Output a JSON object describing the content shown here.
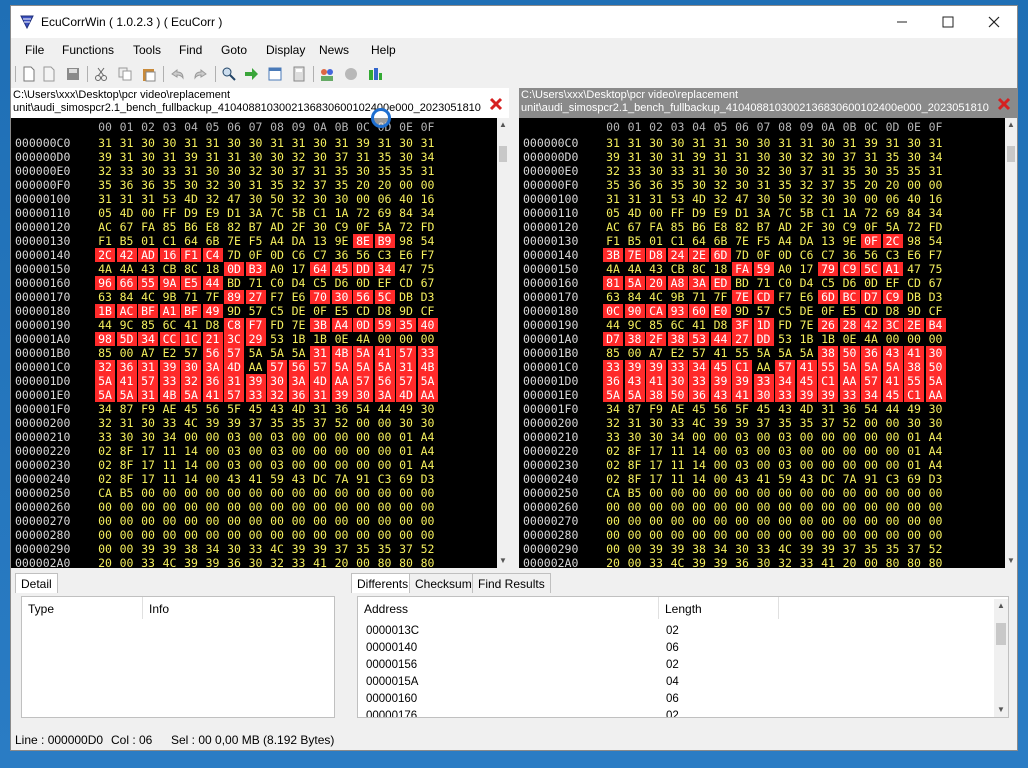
{
  "window": {
    "title": "EcuCorrWin ( 1.0.2.3 ) ( EcuCorr )"
  },
  "menu": [
    "File",
    "Functions",
    "Tools",
    "Find",
    "Goto",
    "Display",
    "News",
    "Help"
  ],
  "toolbar_icons": [
    "new-file-icon",
    "open-file-icon",
    "save-icon",
    "cut-icon",
    "copy-icon",
    "paste-icon",
    "undo-icon",
    "redo-icon",
    "search-icon",
    "goto-arrow-icon",
    "window-icon",
    "calculator-icon",
    "users-icon",
    "record-icon",
    "chart-icon"
  ],
  "left_pane": {
    "path_line1": "C:\\Users\\xxx\\Desktop\\pcr video\\replacement",
    "path_line2": "unit\\audi_simospcr2.1_bench_fullbackup_4104088103002136830600102400e000_2023051810"
  },
  "right_pane": {
    "path_line1": "C:\\Users\\xxx\\Desktop\\pcr video\\replacement",
    "path_line2": "unit\\audi_simospcr2.1_bench_fullbackup_4104088103002136830600102400e000_2023051810"
  },
  "column_header": [
    "00",
    "01",
    "02",
    "03",
    "04",
    "05",
    "06",
    "07",
    "08",
    "09",
    "0A",
    "0B",
    "0C",
    "0D",
    "0E",
    "0F"
  ],
  "addresses": [
    "000000C0",
    "000000D0",
    "000000E0",
    "000000F0",
    "00000100",
    "00000110",
    "00000120",
    "00000130",
    "00000140",
    "00000150",
    "00000160",
    "00000170",
    "00000180",
    "00000190",
    "000001A0",
    "000001B0",
    "000001C0",
    "000001D0",
    "000001E0",
    "000001F0",
    "00000200",
    "00000210",
    "00000220",
    "00000230",
    "00000240",
    "00000250",
    "00000260",
    "00000270",
    "00000280",
    "00000290",
    "000002A0"
  ],
  "left_rows": [
    [
      "31",
      "31",
      "30",
      "30",
      "31",
      "31",
      "30",
      "30",
      "31",
      "31",
      "30",
      "31",
      "39",
      "31",
      "30",
      "31"
    ],
    [
      "39",
      "31",
      "30",
      "31",
      "39",
      "31",
      "31",
      "30",
      "30",
      "32",
      "30",
      "37",
      "31",
      "35",
      "30",
      "34"
    ],
    [
      "32",
      "33",
      "30",
      "33",
      "31",
      "30",
      "30",
      "32",
      "30",
      "37",
      "31",
      "35",
      "30",
      "35",
      "35",
      "31"
    ],
    [
      "35",
      "36",
      "36",
      "35",
      "30",
      "32",
      "30",
      "31",
      "35",
      "32",
      "37",
      "35",
      "20",
      "20",
      "00",
      "00"
    ],
    [
      "31",
      "31",
      "31",
      "53",
      "4D",
      "32",
      "47",
      "30",
      "50",
      "32",
      "30",
      "30",
      "00",
      "06",
      "40",
      "16"
    ],
    [
      "05",
      "4D",
      "00",
      "FF",
      "D9",
      "E9",
      "D1",
      "3A",
      "7C",
      "5B",
      "C1",
      "1A",
      "72",
      "69",
      "84",
      "34"
    ],
    [
      "AC",
      "67",
      "FA",
      "85",
      "B6",
      "E8",
      "82",
      "B7",
      "AD",
      "2F",
      "30",
      "C9",
      "0F",
      "5A",
      "72",
      "FD"
    ],
    [
      "F1",
      "B5",
      "01",
      "C1",
      "64",
      "6B",
      "7E",
      "F5",
      "A4",
      "DA",
      "13",
      "9E",
      "8E",
      "B9",
      "98",
      "54"
    ],
    [
      "2C",
      "42",
      "AD",
      "16",
      "F1",
      "C4",
      "7D",
      "0F",
      "0D",
      "C6",
      "C7",
      "36",
      "56",
      "C3",
      "E6",
      "F7"
    ],
    [
      "4A",
      "4A",
      "43",
      "CB",
      "8C",
      "18",
      "0D",
      "B3",
      "A0",
      "17",
      "64",
      "45",
      "DD",
      "34",
      "47",
      "75"
    ],
    [
      "96",
      "66",
      "55",
      "9A",
      "E5",
      "44",
      "BD",
      "71",
      "C0",
      "D4",
      "C5",
      "D6",
      "0D",
      "EF",
      "CD",
      "67"
    ],
    [
      "63",
      "84",
      "4C",
      "9B",
      "71",
      "7F",
      "89",
      "27",
      "F7",
      "E6",
      "70",
      "30",
      "56",
      "5C",
      "DB",
      "D3"
    ],
    [
      "1B",
      "AC",
      "BF",
      "A1",
      "BF",
      "49",
      "9D",
      "57",
      "C5",
      "DE",
      "0F",
      "E5",
      "CD",
      "D8",
      "9D",
      "CF"
    ],
    [
      "44",
      "9C",
      "85",
      "6C",
      "41",
      "D8",
      "C8",
      "F7",
      "FD",
      "7E",
      "3B",
      "A4",
      "0D",
      "59",
      "35",
      "40"
    ],
    [
      "98",
      "5D",
      "34",
      "CC",
      "1C",
      "21",
      "3C",
      "29",
      "53",
      "1B",
      "1B",
      "0E",
      "4A",
      "00",
      "00",
      "00"
    ],
    [
      "85",
      "00",
      "A7",
      "E2",
      "57",
      "56",
      "57",
      "5A",
      "5A",
      "5A",
      "31",
      "4B",
      "5A",
      "41",
      "57",
      "33"
    ],
    [
      "32",
      "36",
      "31",
      "39",
      "30",
      "3A",
      "4D",
      "AA",
      "57",
      "56",
      "57",
      "5A",
      "5A",
      "5A",
      "31",
      "4B"
    ],
    [
      "5A",
      "41",
      "57",
      "33",
      "32",
      "36",
      "31",
      "39",
      "30",
      "3A",
      "4D",
      "AA",
      "57",
      "56",
      "57",
      "5A"
    ],
    [
      "5A",
      "5A",
      "31",
      "4B",
      "5A",
      "41",
      "57",
      "33",
      "32",
      "36",
      "31",
      "39",
      "30",
      "3A",
      "4D",
      "AA"
    ],
    [
      "34",
      "87",
      "F9",
      "AE",
      "45",
      "56",
      "5F",
      "45",
      "43",
      "4D",
      "31",
      "36",
      "54",
      "44",
      "49",
      "30"
    ],
    [
      "32",
      "31",
      "30",
      "33",
      "4C",
      "39",
      "39",
      "37",
      "35",
      "35",
      "37",
      "52",
      "00",
      "00",
      "30",
      "30"
    ],
    [
      "33",
      "30",
      "30",
      "34",
      "00",
      "00",
      "03",
      "00",
      "03",
      "00",
      "00",
      "00",
      "00",
      "00",
      "01",
      "A4"
    ],
    [
      "02",
      "8F",
      "17",
      "11",
      "14",
      "00",
      "03",
      "00",
      "03",
      "00",
      "00",
      "00",
      "00",
      "00",
      "01",
      "A4"
    ],
    [
      "02",
      "8F",
      "17",
      "11",
      "14",
      "00",
      "03",
      "00",
      "03",
      "00",
      "00",
      "00",
      "00",
      "00",
      "01",
      "A4"
    ],
    [
      "02",
      "8F",
      "17",
      "11",
      "14",
      "00",
      "43",
      "41",
      "59",
      "43",
      "DC",
      "7A",
      "91",
      "C3",
      "69",
      "D3"
    ],
    [
      "CA",
      "B5",
      "00",
      "00",
      "00",
      "00",
      "00",
      "00",
      "00",
      "00",
      "00",
      "00",
      "00",
      "00",
      "00",
      "00"
    ],
    [
      "00",
      "00",
      "00",
      "00",
      "00",
      "00",
      "00",
      "00",
      "00",
      "00",
      "00",
      "00",
      "00",
      "00",
      "00",
      "00"
    ],
    [
      "00",
      "00",
      "00",
      "00",
      "00",
      "00",
      "00",
      "00",
      "00",
      "00",
      "00",
      "00",
      "00",
      "00",
      "00",
      "00"
    ],
    [
      "00",
      "00",
      "00",
      "00",
      "00",
      "00",
      "00",
      "00",
      "00",
      "00",
      "00",
      "00",
      "00",
      "00",
      "00",
      "00"
    ],
    [
      "00",
      "00",
      "39",
      "39",
      "38",
      "34",
      "30",
      "33",
      "4C",
      "39",
      "39",
      "37",
      "35",
      "35",
      "37",
      "52"
    ],
    [
      "20",
      "00",
      "33",
      "4C",
      "39",
      "39",
      "36",
      "30",
      "32",
      "33",
      "41",
      "20",
      "00",
      "80",
      "80",
      "80"
    ]
  ],
  "left_hl": [
    [],
    [],
    [],
    [],
    [],
    [],
    [],
    [
      12,
      13
    ],
    [
      0,
      1,
      2,
      3,
      4,
      5
    ],
    [
      6,
      7,
      10,
      11,
      12,
      13
    ],
    [
      0,
      1,
      2,
      3,
      4,
      5
    ],
    [
      6,
      7,
      10,
      11,
      12,
      13
    ],
    [
      0,
      1,
      2,
      3,
      4,
      5
    ],
    [
      6,
      7,
      10,
      11,
      12,
      13,
      14,
      15
    ],
    [
      0,
      1,
      2,
      3,
      4,
      5,
      6,
      7
    ],
    [
      5,
      6,
      10,
      11,
      12,
      13,
      14,
      15
    ],
    [
      0,
      1,
      2,
      3,
      4,
      5,
      6,
      8,
      9,
      10,
      11,
      12,
      13,
      14,
      15
    ],
    [
      0,
      1,
      2,
      3,
      4,
      5,
      6,
      7,
      8,
      9,
      10,
      11,
      12,
      13,
      14,
      15
    ],
    [
      0,
      1,
      2,
      3,
      4,
      5,
      6,
      7,
      8,
      9,
      10,
      11,
      12,
      13,
      14,
      15
    ],
    [],
    [],
    [],
    [],
    [],
    [],
    [],
    [],
    [],
    [],
    [],
    []
  ],
  "right_rows": [
    [
      "31",
      "31",
      "30",
      "30",
      "31",
      "31",
      "30",
      "30",
      "31",
      "31",
      "30",
      "31",
      "39",
      "31",
      "30",
      "31"
    ],
    [
      "39",
      "31",
      "30",
      "31",
      "39",
      "31",
      "31",
      "30",
      "30",
      "32",
      "30",
      "37",
      "31",
      "35",
      "30",
      "34"
    ],
    [
      "32",
      "33",
      "30",
      "33",
      "31",
      "30",
      "30",
      "32",
      "30",
      "37",
      "31",
      "35",
      "30",
      "35",
      "35",
      "31"
    ],
    [
      "35",
      "36",
      "36",
      "35",
      "30",
      "32",
      "30",
      "31",
      "35",
      "32",
      "37",
      "35",
      "20",
      "20",
      "00",
      "00"
    ],
    [
      "31",
      "31",
      "31",
      "53",
      "4D",
      "32",
      "47",
      "30",
      "50",
      "32",
      "30",
      "30",
      "00",
      "06",
      "40",
      "16"
    ],
    [
      "05",
      "4D",
      "00",
      "FF",
      "D9",
      "E9",
      "D1",
      "3A",
      "7C",
      "5B",
      "C1",
      "1A",
      "72",
      "69",
      "84",
      "34"
    ],
    [
      "AC",
      "67",
      "FA",
      "85",
      "B6",
      "E8",
      "82",
      "B7",
      "AD",
      "2F",
      "30",
      "C9",
      "0F",
      "5A",
      "72",
      "FD"
    ],
    [
      "F1",
      "B5",
      "01",
      "C1",
      "64",
      "6B",
      "7E",
      "F5",
      "A4",
      "DA",
      "13",
      "9E",
      "0F",
      "2C",
      "98",
      "54"
    ],
    [
      "3B",
      "7E",
      "D8",
      "24",
      "2E",
      "6D",
      "7D",
      "0F",
      "0D",
      "C6",
      "C7",
      "36",
      "56",
      "C3",
      "E6",
      "F7"
    ],
    [
      "4A",
      "4A",
      "43",
      "CB",
      "8C",
      "18",
      "FA",
      "59",
      "A0",
      "17",
      "79",
      "C9",
      "5C",
      "A1",
      "47",
      "75"
    ],
    [
      "81",
      "5A",
      "20",
      "A8",
      "3A",
      "ED",
      "BD",
      "71",
      "C0",
      "D4",
      "C5",
      "D6",
      "0D",
      "EF",
      "CD",
      "67"
    ],
    [
      "63",
      "84",
      "4C",
      "9B",
      "71",
      "7F",
      "7E",
      "CD",
      "F7",
      "E6",
      "6D",
      "BC",
      "D7",
      "C9",
      "DB",
      "D3"
    ],
    [
      "0C",
      "90",
      "CA",
      "93",
      "60",
      "E0",
      "9D",
      "57",
      "C5",
      "DE",
      "0F",
      "E5",
      "CD",
      "D8",
      "9D",
      "CF"
    ],
    [
      "44",
      "9C",
      "85",
      "6C",
      "41",
      "D8",
      "3F",
      "1D",
      "FD",
      "7E",
      "26",
      "28",
      "42",
      "3C",
      "2E",
      "B4"
    ],
    [
      "D7",
      "38",
      "2F",
      "38",
      "53",
      "44",
      "27",
      "DD",
      "53",
      "1B",
      "1B",
      "0E",
      "4A",
      "00",
      "00",
      "00"
    ],
    [
      "85",
      "00",
      "A7",
      "E2",
      "57",
      "41",
      "55",
      "5A",
      "5A",
      "5A",
      "38",
      "50",
      "36",
      "43",
      "41",
      "30"
    ],
    [
      "33",
      "39",
      "39",
      "33",
      "34",
      "45",
      "C1",
      "AA",
      "57",
      "41",
      "55",
      "5A",
      "5A",
      "5A",
      "38",
      "50"
    ],
    [
      "36",
      "43",
      "41",
      "30",
      "33",
      "39",
      "39",
      "33",
      "34",
      "45",
      "C1",
      "AA",
      "57",
      "41",
      "55",
      "5A"
    ],
    [
      "5A",
      "5A",
      "38",
      "50",
      "36",
      "43",
      "41",
      "30",
      "33",
      "39",
      "39",
      "33",
      "34",
      "45",
      "C1",
      "AA"
    ],
    [
      "34",
      "87",
      "F9",
      "AE",
      "45",
      "56",
      "5F",
      "45",
      "43",
      "4D",
      "31",
      "36",
      "54",
      "44",
      "49",
      "30"
    ],
    [
      "32",
      "31",
      "30",
      "33",
      "4C",
      "39",
      "39",
      "37",
      "35",
      "35",
      "37",
      "52",
      "00",
      "00",
      "30",
      "30"
    ],
    [
      "33",
      "30",
      "30",
      "34",
      "00",
      "00",
      "03",
      "00",
      "03",
      "00",
      "00",
      "00",
      "00",
      "00",
      "01",
      "A4"
    ],
    [
      "02",
      "8F",
      "17",
      "11",
      "14",
      "00",
      "03",
      "00",
      "03",
      "00",
      "00",
      "00",
      "00",
      "00",
      "01",
      "A4"
    ],
    [
      "02",
      "8F",
      "17",
      "11",
      "14",
      "00",
      "03",
      "00",
      "03",
      "00",
      "00",
      "00",
      "00",
      "00",
      "01",
      "A4"
    ],
    [
      "02",
      "8F",
      "17",
      "11",
      "14",
      "00",
      "43",
      "41",
      "59",
      "43",
      "DC",
      "7A",
      "91",
      "C3",
      "69",
      "D3"
    ],
    [
      "CA",
      "B5",
      "00",
      "00",
      "00",
      "00",
      "00",
      "00",
      "00",
      "00",
      "00",
      "00",
      "00",
      "00",
      "00",
      "00"
    ],
    [
      "00",
      "00",
      "00",
      "00",
      "00",
      "00",
      "00",
      "00",
      "00",
      "00",
      "00",
      "00",
      "00",
      "00",
      "00",
      "00"
    ],
    [
      "00",
      "00",
      "00",
      "00",
      "00",
      "00",
      "00",
      "00",
      "00",
      "00",
      "00",
      "00",
      "00",
      "00",
      "00",
      "00"
    ],
    [
      "00",
      "00",
      "00",
      "00",
      "00",
      "00",
      "00",
      "00",
      "00",
      "00",
      "00",
      "00",
      "00",
      "00",
      "00",
      "00"
    ],
    [
      "00",
      "00",
      "39",
      "39",
      "38",
      "34",
      "30",
      "33",
      "4C",
      "39",
      "39",
      "37",
      "35",
      "35",
      "37",
      "52"
    ],
    [
      "20",
      "00",
      "33",
      "4C",
      "39",
      "39",
      "36",
      "30",
      "32",
      "33",
      "41",
      "20",
      "00",
      "80",
      "80",
      "80"
    ]
  ],
  "right_hl": [
    [],
    [],
    [],
    [],
    [],
    [],
    [],
    [
      12,
      13
    ],
    [
      0,
      1,
      2,
      3,
      4,
      5
    ],
    [
      6,
      7,
      10,
      11,
      12,
      13
    ],
    [
      0,
      1,
      2,
      3,
      4,
      5
    ],
    [
      6,
      7,
      10,
      11,
      12,
      13
    ],
    [
      0,
      1,
      2,
      3,
      4,
      5
    ],
    [
      6,
      7,
      10,
      11,
      12,
      13,
      14,
      15
    ],
    [
      0,
      1,
      2,
      3,
      4,
      5,
      6,
      7
    ],
    [
      10,
      11,
      12,
      13,
      14,
      15
    ],
    [
      0,
      1,
      2,
      3,
      4,
      5,
      6,
      8,
      9,
      10,
      11,
      12,
      13,
      14,
      15
    ],
    [
      0,
      1,
      2,
      3,
      4,
      5,
      6,
      7,
      8,
      9,
      10,
      11,
      12,
      13,
      14,
      15
    ],
    [
      0,
      1,
      2,
      3,
      4,
      5,
      6,
      7,
      8,
      9,
      10,
      11,
      12,
      13,
      14,
      15
    ],
    [],
    [],
    [],
    [],
    [],
    [],
    [],
    [],
    [],
    [],
    [],
    []
  ],
  "detail": {
    "tab": "Detail",
    "col_type": "Type",
    "col_info": "Info"
  },
  "diff_tabs": [
    "Differents",
    "Checksum",
    "Find Results"
  ],
  "diff_list": {
    "col_address": "Address",
    "col_length": "Length",
    "rows": [
      {
        "address": "0000013C",
        "length": "02"
      },
      {
        "address": "00000140",
        "length": "06"
      },
      {
        "address": "00000156",
        "length": "02"
      },
      {
        "address": "0000015A",
        "length": "04"
      },
      {
        "address": "00000160",
        "length": "06"
      },
      {
        "address": "00000176",
        "length": "02"
      }
    ]
  },
  "status": {
    "line": "Line :  000000D0",
    "col": "Col :  06",
    "sel": "Sel :  00  0,00 MB (8.192 Bytes)"
  },
  "colors": {
    "hex_bg": "#000000",
    "hex_text": "#f5ef5e",
    "diff_highlight": "#ff2a2a",
    "close_red": "#d62020"
  }
}
